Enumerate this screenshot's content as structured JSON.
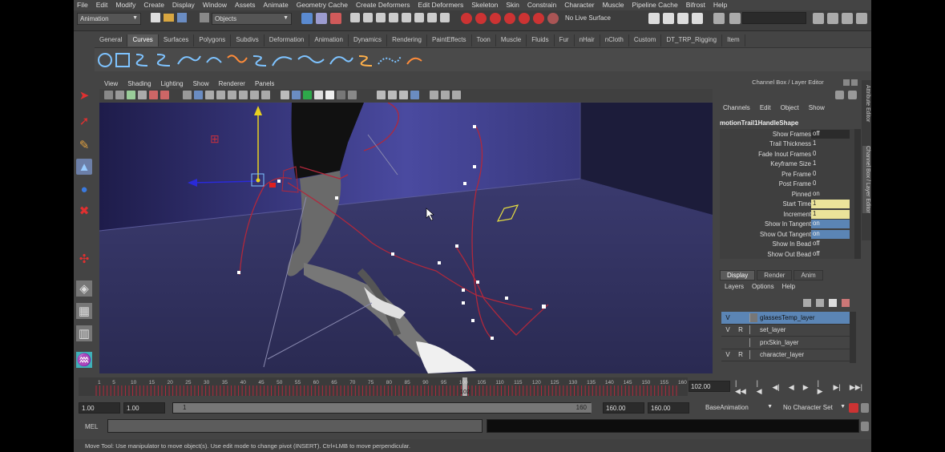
{
  "menubar": [
    "File",
    "Edit",
    "Modify",
    "Create",
    "Display",
    "Window",
    "Assets",
    "Animate",
    "Geometry Cache",
    "Create Deformers",
    "Edit Deformers",
    "Skeleton",
    "Skin",
    "Constrain",
    "Character",
    "Muscle",
    "Pipeline Cache",
    "Bifrost",
    "Help"
  ],
  "statusline": {
    "menuset": "Animation",
    "selection_mode": "Objects",
    "live_surface": "No Live Surface"
  },
  "shelf_tabs": [
    "General",
    "Curves",
    "Surfaces",
    "Polygons",
    "Subdivs",
    "Deformation",
    "Animation",
    "Dynamics",
    "Rendering",
    "PaintEffects",
    "Toon",
    "Muscle",
    "Fluids",
    "Fur",
    "nHair",
    "nCloth",
    "Custom",
    "DT_TRP_Rigging",
    "Item"
  ],
  "shelf_active": "Curves",
  "viewport": {
    "menu": [
      "View",
      "Shading",
      "Lighting",
      "Show",
      "Renderer",
      "Panels"
    ]
  },
  "channel_box": {
    "title": "Channel Box / Layer Editor",
    "menu": [
      "Channels",
      "Edit",
      "Object",
      "Show"
    ],
    "node": "motionTrail1HandleShape",
    "attrs": [
      {
        "name": "Show Frames",
        "value": "off",
        "hl": ""
      },
      {
        "name": "Trail Thickness",
        "value": "1",
        "hl": ""
      },
      {
        "name": "Fade Inout Frames",
        "value": "0",
        "hl": ""
      },
      {
        "name": "Keyframe Size",
        "value": "1",
        "hl": ""
      },
      {
        "name": "Pre Frame",
        "value": "0",
        "hl": ""
      },
      {
        "name": "Post Frame",
        "value": "0",
        "hl": ""
      },
      {
        "name": "Pinned",
        "value": "on",
        "hl": ""
      },
      {
        "name": "Start Time",
        "value": "1",
        "hl": "yellow"
      },
      {
        "name": "Increment",
        "value": "1",
        "hl": "yellow"
      },
      {
        "name": "Show In Tangent",
        "value": "on",
        "hl": "blue"
      },
      {
        "name": "Show Out Tangent",
        "value": "on",
        "hl": "blue"
      },
      {
        "name": "Show In Bead",
        "value": "off",
        "hl": ""
      },
      {
        "name": "Show Out Bead",
        "value": "off",
        "hl": ""
      }
    ]
  },
  "side_tabs": [
    "Attribute Editor",
    "Channel Box / Layer Editor"
  ],
  "layer_editor": {
    "tabs": [
      "Display",
      "Render",
      "Anim"
    ],
    "active_tab": "Display",
    "menu": [
      "Layers",
      "Options",
      "Help"
    ],
    "layers": [
      {
        "v": "V",
        "r": "",
        "name": "glassesTemp_layer",
        "selected": true
      },
      {
        "v": "V",
        "r": "R",
        "name": "set_layer",
        "selected": false
      },
      {
        "v": "",
        "r": "",
        "name": "prxSkin_layer",
        "selected": false
      },
      {
        "v": "V",
        "r": "R",
        "name": "character_layer",
        "selected": false
      }
    ]
  },
  "timeline": {
    "ticks": [
      "1",
      "5",
      "10",
      "15",
      "20",
      "25",
      "30",
      "35",
      "40",
      "45",
      "50",
      "55",
      "60",
      "65",
      "70",
      "75",
      "80",
      "85",
      "90",
      "95",
      "100",
      "105",
      "110",
      "115",
      "120",
      "125",
      "130",
      "135",
      "140",
      "145",
      "150",
      "155",
      "160"
    ],
    "current_frame": "102",
    "current_time_field": "102.00"
  },
  "range": {
    "start": "1.00",
    "playback_start": "1.00",
    "range_start_label": "1",
    "range_end_label": "160",
    "playback_end": "160.00",
    "end": "160.00",
    "anim_layer": "BaseAnimation",
    "character_set": "No Character Set"
  },
  "commandline": {
    "label": "MEL"
  },
  "helpline": "Move Tool: Use manipulator to move object(s). Use edit mode to change pivot (INSERT). Ctrl+LMB to move perpendicular."
}
